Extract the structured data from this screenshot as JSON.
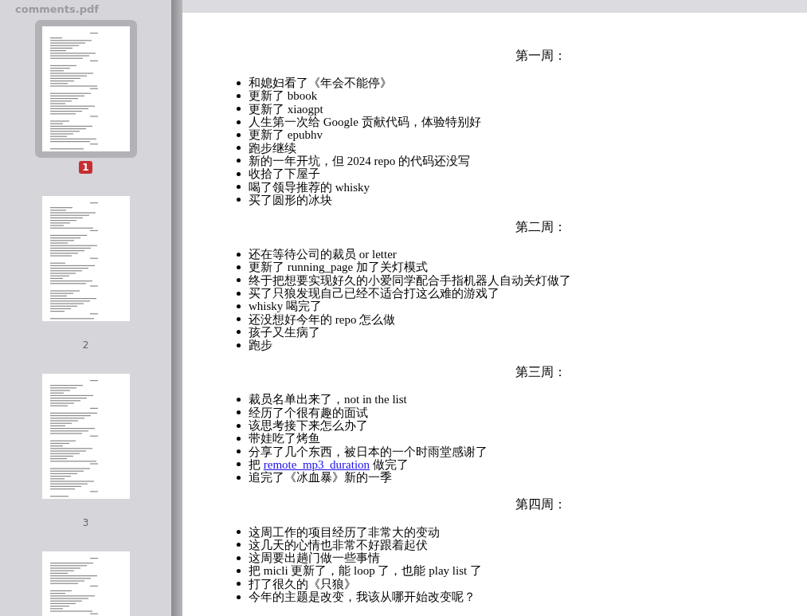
{
  "sidebar": {
    "title": "comments.pdf",
    "thumbnails": [
      {
        "label": "1",
        "selected": true
      },
      {
        "label": "2",
        "selected": false
      },
      {
        "label": "3",
        "selected": false
      },
      {
        "selected": false
      }
    ]
  },
  "document": {
    "sections": [
      {
        "heading": "第一周：",
        "items": [
          {
            "parts": [
              {
                "text": "和媳妇看了《年会不能停》"
              }
            ]
          },
          {
            "parts": [
              {
                "text": "更新了 bbook"
              }
            ]
          },
          {
            "parts": [
              {
                "text": "更新了 xiaogpt"
              }
            ]
          },
          {
            "parts": [
              {
                "text": "人生第一次给 Google 贡献代码，体验特别好"
              }
            ]
          },
          {
            "parts": [
              {
                "text": "更新了 epubhv"
              }
            ]
          },
          {
            "parts": [
              {
                "text": "跑步继续"
              }
            ]
          },
          {
            "parts": [
              {
                "text": "新的一年开坑，但 2024 repo 的代码还没写"
              }
            ]
          },
          {
            "parts": [
              {
                "text": "收拾了下屋子"
              }
            ]
          },
          {
            "parts": [
              {
                "text": "喝了领导推荐的 whisky"
              }
            ]
          },
          {
            "parts": [
              {
                "text": "买了圆形的冰块"
              }
            ]
          }
        ]
      },
      {
        "heading": "第二周：",
        "items": [
          {
            "parts": [
              {
                "text": "还在等待公司的裁员 or letter"
              }
            ]
          },
          {
            "parts": [
              {
                "text": "更新了 running_page 加了关灯模式"
              }
            ]
          },
          {
            "parts": [
              {
                "text": "终于把想要实现好久的小爱同学配合手指机器人自动关灯做了"
              }
            ]
          },
          {
            "parts": [
              {
                "text": "买了只狼发现自己已经不适合打这么难的游戏了"
              }
            ]
          },
          {
            "parts": [
              {
                "text": "whisky 喝完了"
              }
            ]
          },
          {
            "parts": [
              {
                "text": "还没想好今年的 repo 怎么做"
              }
            ]
          },
          {
            "parts": [
              {
                "text": "孩子又生病了"
              }
            ]
          },
          {
            "parts": [
              {
                "text": "跑步"
              }
            ]
          }
        ]
      },
      {
        "heading": "第三周：",
        "items": [
          {
            "parts": [
              {
                "text": "裁员名单出来了，not in the list"
              }
            ]
          },
          {
            "parts": [
              {
                "text": "经历了个很有趣的面试"
              }
            ]
          },
          {
            "parts": [
              {
                "text": "该思考接下来怎么办了"
              }
            ]
          },
          {
            "parts": [
              {
                "text": "带娃吃了烤鱼"
              }
            ]
          },
          {
            "parts": [
              {
                "text": "分享了几个东西，被日本的一个时雨堂感谢了"
              }
            ]
          },
          {
            "parts": [
              {
                "text": "把 "
              },
              {
                "text": "remote_mp3_duration",
                "kind": "link"
              },
              {
                "text": " 做完了"
              }
            ]
          },
          {
            "parts": [
              {
                "text": "追完了《冰血暴》新的一季"
              }
            ]
          }
        ]
      },
      {
        "heading": "第四周：",
        "items": [
          {
            "parts": [
              {
                "text": "这周工作的项目经历了非常大的变动"
              }
            ]
          },
          {
            "parts": [
              {
                "text": "这几天的心情也非常不好跟着起伏"
              }
            ]
          },
          {
            "parts": [
              {
                "text": "这周要出趟门做一些事情"
              }
            ]
          },
          {
            "parts": [
              {
                "text": "把 micli 更新了，能 loop 了，也能 play list 了"
              }
            ]
          },
          {
            "parts": [
              {
                "text": "打了很久的《只狼》"
              }
            ]
          },
          {
            "parts": [
              {
                "text": "今年的主题是改变，我该从哪开始改变呢？"
              }
            ]
          }
        ]
      }
    ]
  }
}
